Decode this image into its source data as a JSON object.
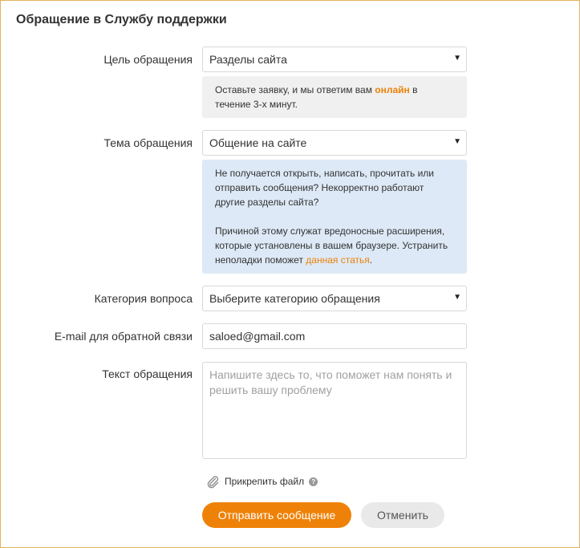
{
  "page": {
    "title": "Обращение в Службу поддержки"
  },
  "form": {
    "purpose": {
      "label": "Цель обращения",
      "value": "Разделы сайта",
      "info": {
        "text_before": "Оставьте заявку, и мы ответим вам ",
        "highlight": "онлайн",
        "text_after": " в течение 3-х минут."
      }
    },
    "topic": {
      "label": "Тема обращения",
      "value": "Общение на сайте",
      "info": {
        "paragraph1": "Не получается открыть, написать, прочитать или отправить сообщения? Некорректно работают другие разделы сайта?",
        "paragraph2_before": "Причиной этому служат вредоносные расширения, которые установлены в вашем браузере. Устранить неполадки поможет ",
        "paragraph2_link": "данная статья",
        "paragraph2_after": "."
      }
    },
    "category": {
      "label": "Категория вопроса",
      "value": "Выберите категорию обращения"
    },
    "email": {
      "label": "E-mail для обратной связи",
      "value": "saloed@gmail.com"
    },
    "message": {
      "label": "Текст обращения",
      "placeholder": "Напишите здесь то, что поможет нам понять и решить вашу проблему"
    },
    "attach_label": "Прикрепить файл",
    "help_symbol": "?",
    "dropdown_arrow": "▼",
    "submit_label": "Отправить сообщение",
    "cancel_label": "Отменить"
  },
  "icons": {
    "attach": "paperclip-icon",
    "help": "question-circle-icon",
    "dropdown": "triangle-down-icon"
  },
  "colors": {
    "accent": "#ee8208",
    "frame_border": "#e4b25a",
    "info_gray": "#f0f0f0",
    "info_blue": "#dde9f6",
    "cancel_bg": "#e9e9e9"
  }
}
